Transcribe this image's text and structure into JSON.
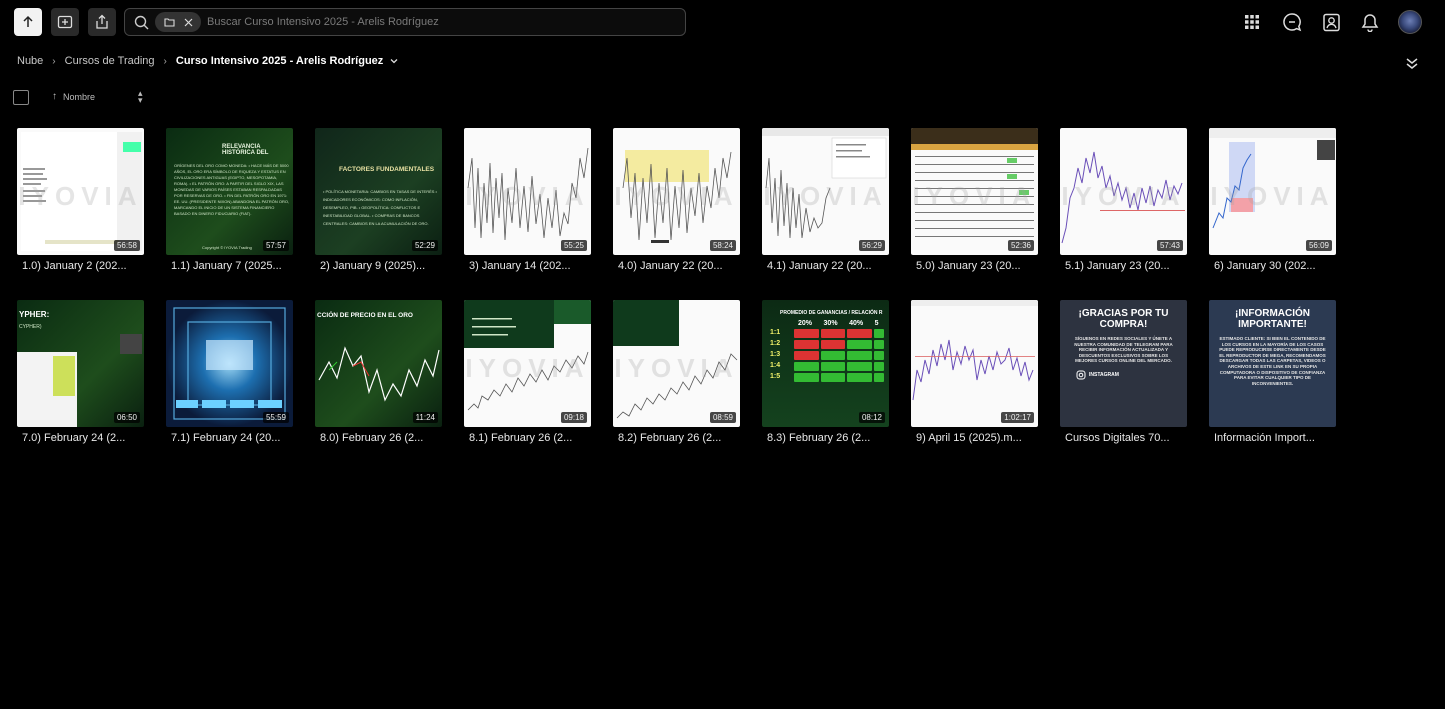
{
  "search": {
    "placeholder": "Buscar Curso Intensivo 2025 - Arelis Rodríguez"
  },
  "breadcrumb": {
    "root": "Nube",
    "parent": "Cursos de Trading",
    "current": "Curso Intensivo 2025 - Arelis Rodríguez"
  },
  "sort": {
    "label": "Nombre"
  },
  "files": [
    {
      "name": "1.0) January 2 (202...",
      "duration": "56:58"
    },
    {
      "name": "1.1) January 7 (2025...",
      "duration": "57:57"
    },
    {
      "name": "2) January 9 (2025)...",
      "duration": "52:29"
    },
    {
      "name": "3) January 14 (202...",
      "duration": "55:25"
    },
    {
      "name": "4.0) January 22 (20...",
      "duration": "58:24"
    },
    {
      "name": "4.1) January 22 (20...",
      "duration": "56:29"
    },
    {
      "name": "5.0) January 23 (20...",
      "duration": "52:36"
    },
    {
      "name": "5.1) January 23 (20...",
      "duration": "57:43"
    },
    {
      "name": "6) January 30 (202...",
      "duration": "56:09"
    },
    {
      "name": "7.0) February 24 (2...",
      "duration": "06:50"
    },
    {
      "name": "7.1) February 24 (20...",
      "duration": "55:59"
    },
    {
      "name": "8.0) February 26 (2...",
      "duration": "11:24"
    },
    {
      "name": "8.1) February 26 (2...",
      "duration": "09:18"
    },
    {
      "name": "8.2) February 26 (2...",
      "duration": "08:59"
    },
    {
      "name": "8.3) February 26 (2...",
      "duration": "08:12"
    },
    {
      "name": "9) April 15 (2025).m...",
      "duration": "1:02:17"
    },
    {
      "name": "Cursos Digitales 70...",
      "duration": ""
    },
    {
      "name": "Información Import...",
      "duration": ""
    }
  ],
  "thumb_text": {
    "t1_title": "RELEVANCIA HISTÓRICA DEL",
    "t1_bullets": "ORÍGENES DEL ORO COMO MONEDA: • HACE MÁS DE 5000 AÑOS, EL ORO ERA SÍMBOLO DE RIQUEZA Y ESTATUS EN CIVILIZACIONES ANTIGUAS (EGIPTO, MESOPOTAMIA, ROMA). • EL PATRÓN ORO: A PARTIR DEL SIGLO XIX, LAS MONEDAS DE VARIOS PAÍSES ESTABAN RESPALDADAS POR RESERVAS DE ORO. • FIN DEL PATRÓN ORO EN 1971: EE. UU. (PRESIDENTE NIXON) ABANDONA EL PATRÓN ORO, MARCANDO EL INICIO DE UN SISTEMA FINANCIERO BASADO EN DINERO FIDUCIARIO (FIAT).",
    "t1_footer": "Copyright © IYOVIA Trading",
    "t2_title": "FACTORES FUNDAMENTALES",
    "t2_bullets": "• POLÍTICA MONETARIA: CAMBIOS EN TASAS DE INTERÉS • INDICADORES ECONÓMICOS: COMO INFLACIÓN, DESEMPLEO, PIB. • GEOPOLÍTICA: CONFLICTOS E INESTABILIDAD GLOBAL. • COMPRAS DE BANCOS CENTRALES: CAMBIOS EN LA ACUMULACIÓN DE ORO.",
    "t3_top": "YPHER:",
    "t3_sub": "CYPHER)",
    "t4_title": "CCIÓN DE PRECIO EN EL ORO",
    "t5_title": "PROMEDIO DE GANANCIAS / RELACIÓN R",
    "t5_cols": [
      "20%",
      "30%",
      "40%",
      "5"
    ],
    "t5_rows": [
      "1:1",
      "1:2",
      "1:3",
      "1:4",
      "1:5"
    ],
    "t6_title": "¡GRACIAS POR TU COMPRA!",
    "t6_body": "SÍGUENOS EN REDES SOCIALES Y ÚNETE A NUESTRA COMUNIDAD DE TELEGRAM PARA RECIBIR INFORMACIÓN ACTUALIZADA Y DESCUENTOS EXCLUSIVOS SOBRE LOS MEJORES CURSOS ONLINE DEL MERCADO.",
    "t6_insta": "INSTAGRAM",
    "t7_title": "¡INFORMACIÓN IMPORTANTE!",
    "t7_body": "ESTIMADO CLIENTE: SI BIEN EL CONTENIDO DE LOS CURSOS EN LA MAYORÍA DE LOS CASOS PUEDE REPRODUCIRSE DIRECTAMENTE DESDE EL REPRODUCTOR DE MEGA, RECOMENDAMOS DESCARGAR TODAS LAS CARPETAS, VIDEOS O ARCHIVOS DE ESTE LINK EN SU PROPIA COMPUTADORA O DISPOSITIVO DE CONFIANZA PARA EVITAR CUALQUIER TIPO DE INCONVENIENTES.",
    "watermark": "IYOVIA"
  },
  "icons": [
    "upload-icon",
    "new-folder-icon",
    "share-icon",
    "search-icon",
    "folder-icon",
    "close-icon",
    "apps-icon",
    "chat-icon",
    "contacts-icon",
    "bell-icon",
    "avatar",
    "collapse-icon"
  ],
  "colors": {
    "background": "#000000",
    "primary_button": "#f2f2f2",
    "text": "#e6e6e6"
  }
}
